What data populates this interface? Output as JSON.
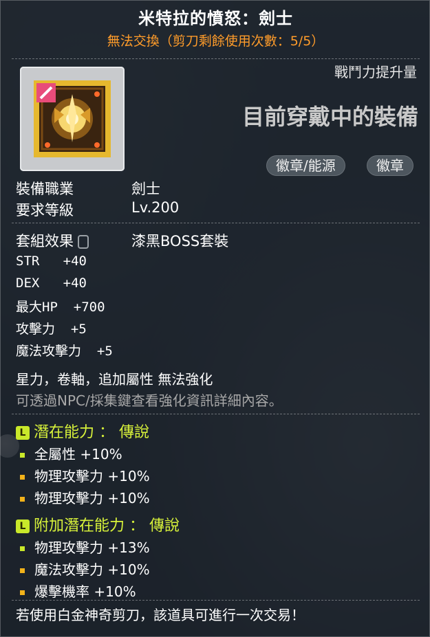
{
  "item": {
    "title": "米特拉的憤怒：劍士",
    "trade_note": "無法交換（剪刀剩餘使用次數：5/5）",
    "icon": "emblem-icon"
  },
  "header": {
    "power_label": "戰鬥力提升量",
    "wearing_label": "目前穿戴中的裝備",
    "tags": [
      "徽章/能源",
      "徽章"
    ]
  },
  "requirements": {
    "job_label": "裝備職業",
    "job_value": "劍士",
    "level_label": "要求等級",
    "level_value": "Lv.200"
  },
  "set": {
    "label": "套組效果",
    "value": "漆黑BOSS套裝"
  },
  "stats": [
    {
      "name": "STR",
      "value": "+40"
    },
    {
      "name": "DEX",
      "value": "+40"
    },
    {
      "name": "最大HP",
      "value": "+700"
    },
    {
      "name": "攻擊力",
      "value": "+5"
    },
    {
      "name": "魔法攻擊力",
      "value": "+5"
    }
  ],
  "notes": {
    "cannot_enhance": "星力，卷軸，追加屬性 無法強化",
    "info": "可透過NPC/採集鍵查看強化資訊詳細內容。"
  },
  "potential": {
    "badge": "L",
    "header": "潛在能力 ： 傳說",
    "lines": [
      {
        "name": "全屬性",
        "value": "+10%"
      },
      {
        "name": "物理攻擊力",
        "value": "+10%"
      },
      {
        "name": "物理攻擊力",
        "value": "+10%"
      }
    ]
  },
  "bonus_potential": {
    "badge": "L",
    "header": "附加潛在能力 ： 傳說",
    "lines": [
      {
        "name": "物理攻擊力",
        "value": "+13%"
      },
      {
        "name": "魔法攻擊力",
        "value": "+10%"
      },
      {
        "name": "爆擊機率",
        "value": "+10%"
      }
    ]
  },
  "footer": "若使用白金神奇剪刀，該道具可進行一次交易！",
  "colors": {
    "title": "#ffffff",
    "trade_note": "#ff9c2a",
    "potential_header": "#d8f23a",
    "bullet_first": "#c9e82a",
    "bullet": "#f2b21a",
    "info_text": "#a8a8a8"
  }
}
